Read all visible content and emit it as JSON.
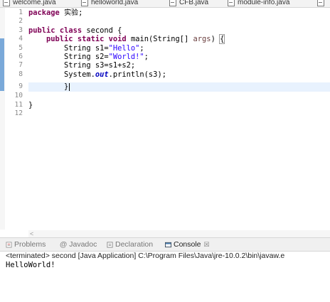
{
  "editor_tabs": [
    "welcome.java",
    "helloworld.java",
    "CFB.java",
    "module-info.java"
  ],
  "line_numbers": [
    "1",
    "2",
    "3",
    "4",
    "5",
    "6",
    "7",
    "8",
    "9",
    "10",
    "11",
    "12"
  ],
  "code": {
    "l1_kw": "package",
    "l1_name": "实验",
    "l1_end": ";",
    "l3_kw1": "public",
    "l3_kw2": "class",
    "l3_rest": " second {",
    "l4_kw1": "public",
    "l4_kw2": "static",
    "l4_kw3": "void",
    "l4_mid": " main(String[] ",
    "l4_param": "args",
    "l4_close": ") ",
    "l4_brace": "{",
    "l5_type": "String s1=",
    "l5_str": "\"Hello\"",
    "l5_end": ";",
    "l6_type": "String s2=",
    "l6_str": "\"World!\"",
    "l6_end": ";",
    "l7": "String s3=s1+s2;",
    "l8_pre": "System.",
    "l8_field": "out",
    "l8_post": ".println(s3);",
    "l9": "}",
    "l11": "}"
  },
  "editor_scroll_glyph": "<",
  "view_tabs": {
    "problems": "Problems",
    "javadoc": "Javadoc",
    "declaration": "Declaration",
    "console": "Console",
    "console_close": "☒"
  },
  "console": {
    "terminated": "<terminated> second [Java Application] C:\\Program Files\\Java\\jre-10.0.2\\bin\\javaw.e",
    "output": "HelloWorld!"
  }
}
